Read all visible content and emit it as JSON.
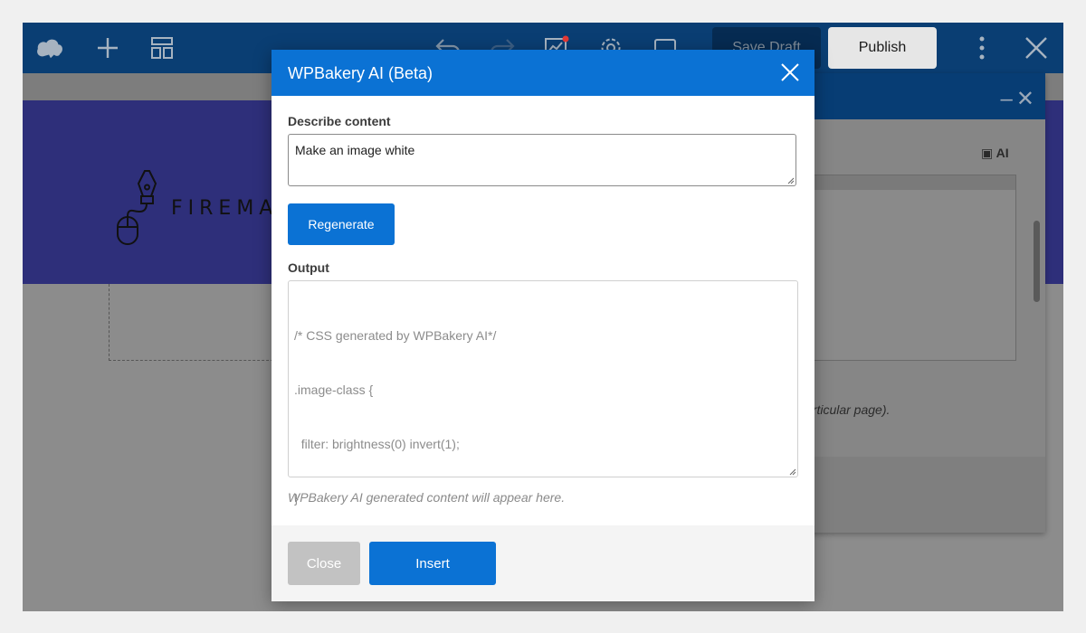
{
  "toolbar": {
    "icons": [
      "cloud-logo-icon",
      "plus-icon",
      "layout-icon",
      "undo-icon",
      "redo-icon",
      "seo-chart-icon",
      "settings-gear-icon",
      "responsive-view-icon",
      "more-vertical-icon",
      "close-icon"
    ],
    "save_draft_label": "Save Draft",
    "publish_label": "Publish"
  },
  "page": {
    "logo_text": "FIREMAR",
    "background_note": "articular page).",
    "ai_badge": "AI"
  },
  "modal": {
    "title": "WPBakery AI (Beta)",
    "describe_label": "Describe content",
    "describe_value": "Make an image white",
    "regenerate_label": "Regenerate",
    "output_label": "Output",
    "output_lines": [
      "/* CSS generated by WPBakery AI*/",
      ".image-class {",
      "  filter: brightness(0) invert(1);",
      "}"
    ],
    "helper_text": "WPBakery AI generated content will appear here.",
    "close_label": "Close",
    "insert_label": "Insert"
  },
  "colors": {
    "accent": "#0b72d4",
    "toolbar_bg": "#0a3e73",
    "hero_bg": "#2e2f7a",
    "disabled_button": "#c2c2c2"
  }
}
